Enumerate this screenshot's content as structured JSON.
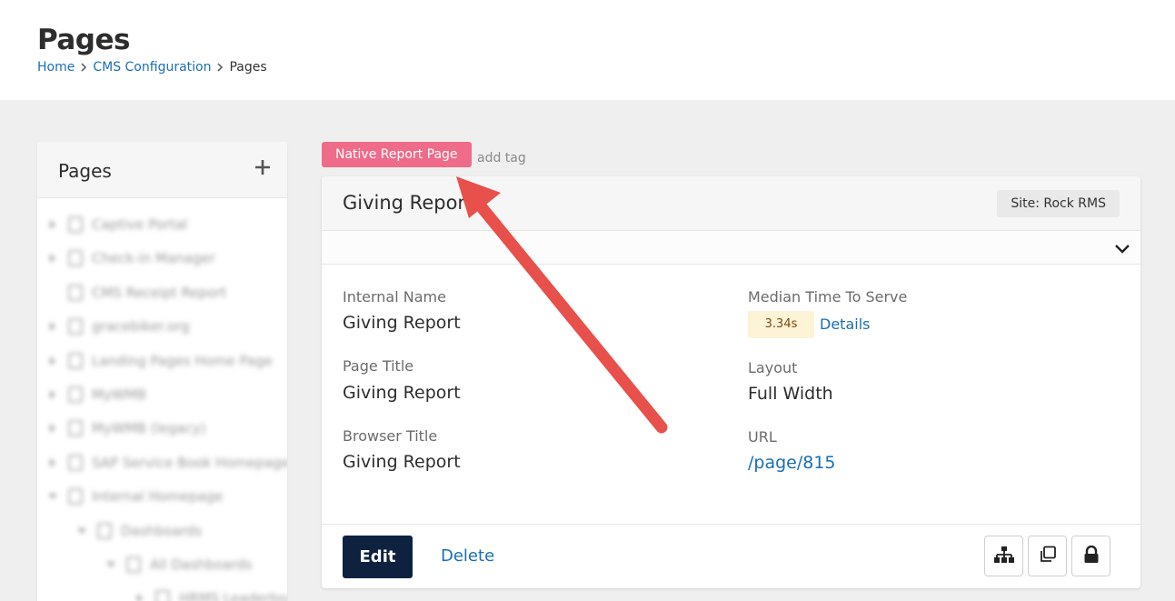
{
  "header": {
    "title": "Pages",
    "breadcrumb": {
      "home": "Home",
      "section": "CMS Configuration",
      "current": "Pages"
    }
  },
  "sidebar": {
    "title": "Pages",
    "items": [
      {
        "label": "Captive Portal",
        "depth": 0,
        "expandable": true
      },
      {
        "label": "Check-in Manager",
        "depth": 0,
        "expandable": true
      },
      {
        "label": "CMS Receipt Report",
        "depth": 0,
        "expandable": false
      },
      {
        "label": "gracebiker.org",
        "depth": 0,
        "expandable": true
      },
      {
        "label": "Landing Pages Home Page",
        "depth": 0,
        "expandable": true
      },
      {
        "label": "MyWMB",
        "depth": 0,
        "expandable": true
      },
      {
        "label": "MyWMB (legacy)",
        "depth": 0,
        "expandable": true
      },
      {
        "label": "SAP Service Book Homepage",
        "depth": 0,
        "expandable": true
      },
      {
        "label": "Internal Homepage",
        "depth": 0,
        "expandable": true,
        "expanded": true
      },
      {
        "label": "Dashboards",
        "depth": 1,
        "expandable": true,
        "expanded": true
      },
      {
        "label": "All Dashboards",
        "depth": 2,
        "expandable": true,
        "expanded": true
      },
      {
        "label": "HRMS Leaderboards",
        "depth": 3,
        "expandable": true
      }
    ]
  },
  "tags": {
    "badge": "Native Report Page",
    "add_tag": "add tag"
  },
  "card": {
    "title": "Giving Report",
    "site": "Site: Rock RMS",
    "fields": {
      "internal_name_label": "Internal Name",
      "internal_name_value": "Giving Report",
      "page_title_label": "Page Title",
      "page_title_value": "Giving Report",
      "browser_title_label": "Browser Title",
      "browser_title_value": "Giving Report",
      "median_label": "Median Time To Serve",
      "median_value": "3.34s",
      "details_link": "Details",
      "layout_label": "Layout",
      "layout_value": "Full Width",
      "url_label": "URL",
      "url_value": "/page/815"
    },
    "actions": {
      "edit": "Edit",
      "delete": "Delete"
    }
  },
  "colors": {
    "tag_badge": "#ef6b8a",
    "edit_button": "#0e2240",
    "link": "#1a6fb5",
    "time_badge_bg": "#fdf3d6",
    "annotation_arrow": "#e8504b"
  },
  "icons": {
    "add": "plus-icon",
    "collapse": "chevron-down-icon",
    "hierarchy": "sitemap-icon",
    "copy": "copy-icon",
    "security": "lock-icon"
  }
}
